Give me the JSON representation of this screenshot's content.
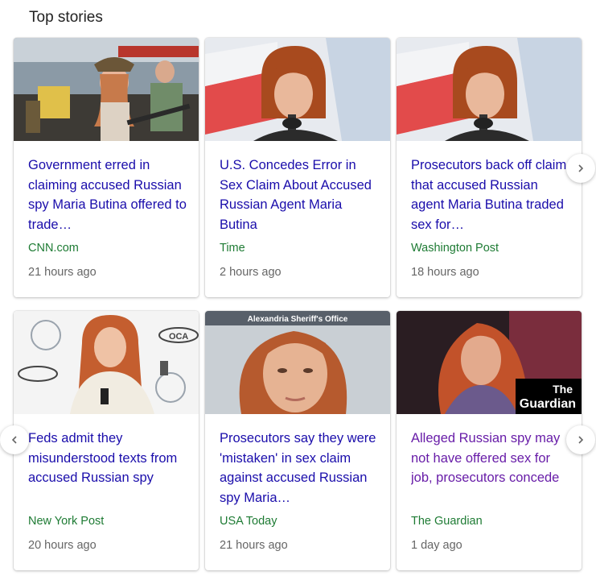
{
  "section": {
    "title": "Top stories"
  },
  "cards": [
    {
      "headline": "Government erred in claiming accused Russian spy Maria Butina offered to trade…",
      "source": "CNN.com",
      "time": "21 hours ago",
      "visited": false
    },
    {
      "headline": "U.S. Concedes Error in Sex Claim About Accused Russian Agent Maria Butina",
      "source": "Time",
      "time": "2 hours ago",
      "visited": false
    },
    {
      "headline": "Prosecutors back off claim that accused Russian agent Maria Butina traded sex for…",
      "source": "Washington Post",
      "time": "18 hours ago",
      "visited": false
    },
    {
      "headline": "Feds admit they misunderstood texts from accused Russian spy",
      "source": "New York Post",
      "time": "20 hours ago",
      "visited": false
    },
    {
      "headline": "Prosecutors say they were 'mistaken' in sex claim against accused Russian spy Maria…",
      "source": "USA Today",
      "time": "21 hours ago",
      "visited": false
    },
    {
      "headline": "Alleged Russian spy may not have offered sex for job, prosecutors concede",
      "source": "The Guardian",
      "time": "1 day ago",
      "visited": true
    }
  ],
  "image_overlays": {
    "mugshot_caption": "Alexandria Sheriff's Office",
    "guardian_logo_line1": "The",
    "guardian_logo_line2": "Guardian",
    "backdrop_logo": "ОСА"
  },
  "nav": {
    "next_icon": "chevron-right-icon",
    "prev_icon": "chevron-left-icon"
  },
  "colors": {
    "link": "#1a0dab",
    "visited_link": "#681da8",
    "source": "#1e7b34",
    "meta": "#666666"
  }
}
